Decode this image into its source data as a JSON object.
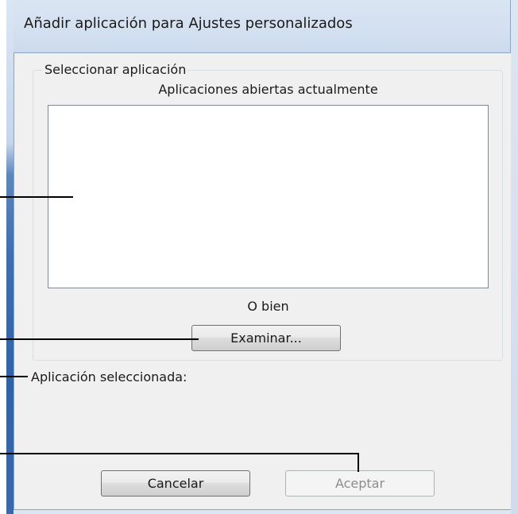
{
  "dialog": {
    "title": "Añadir aplicación para Ajustes personalizados"
  },
  "select_group": {
    "legend": "Seleccionar aplicación",
    "list_caption": "Aplicaciones abiertas actualmente",
    "list_items": [],
    "or_text": "O bien",
    "browse_label": "Examinar..."
  },
  "selected": {
    "label": "Aplicación seleccionada:",
    "value": ""
  },
  "buttons": {
    "cancel_label": "Cancelar",
    "ok_label": "Aceptar",
    "ok_enabled": false
  },
  "colors": {
    "dialog_background": "#f0f0f0",
    "titlebar": "#d3e0f0",
    "frame_accent": "#2f62a7",
    "disabled_text": "#8d8d8d"
  }
}
